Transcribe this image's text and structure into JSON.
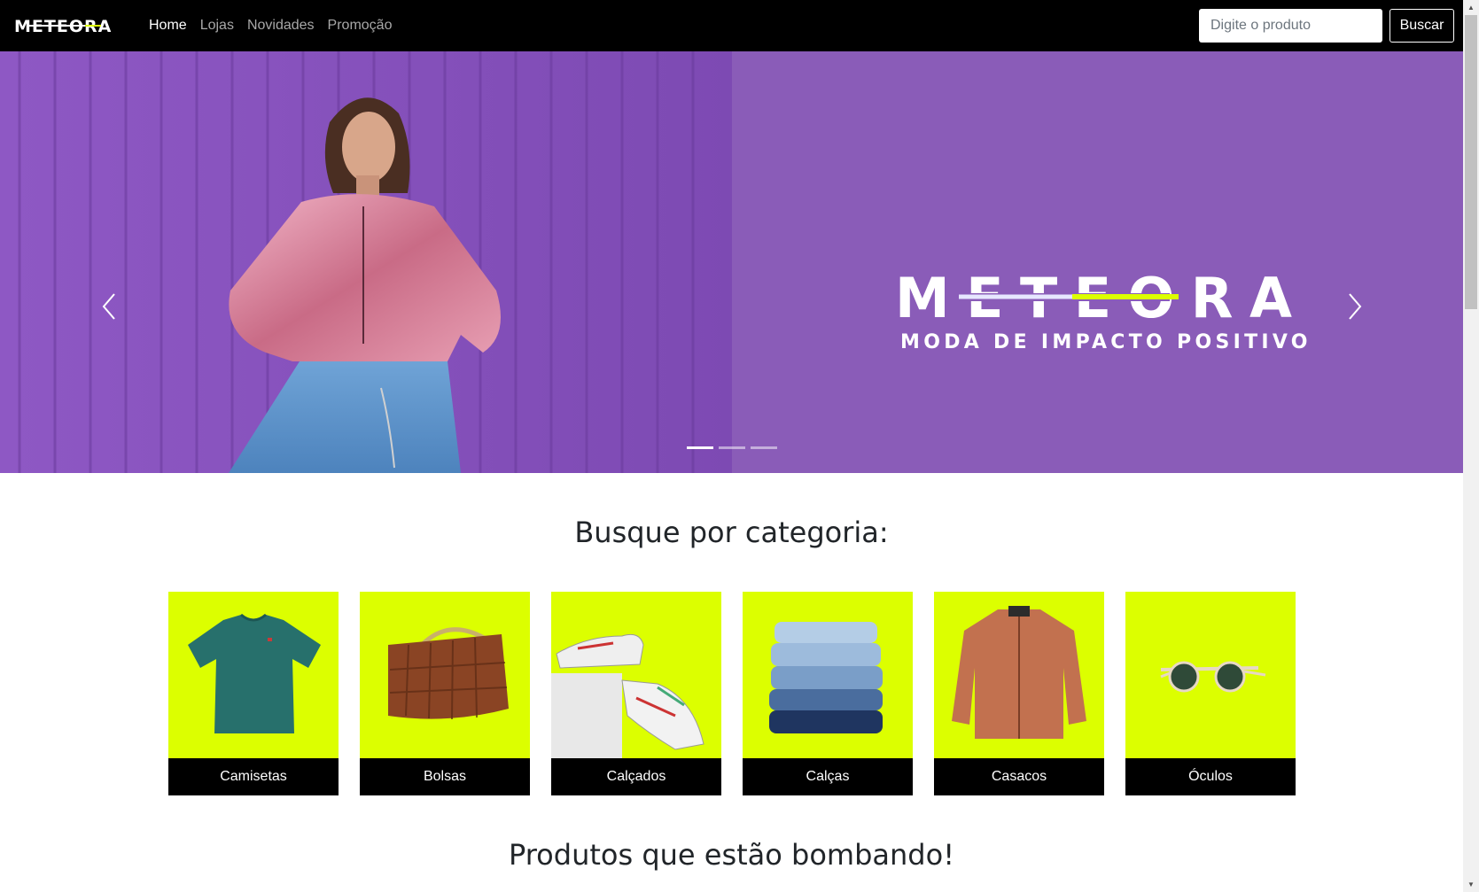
{
  "navbar": {
    "brand": "METEORA",
    "links": [
      {
        "label": "Home",
        "active": true
      },
      {
        "label": "Lojas",
        "active": false
      },
      {
        "label": "Novidades",
        "active": false
      },
      {
        "label": "Promoção",
        "active": false
      }
    ],
    "search_placeholder": "Digite o produto",
    "search_button": "Buscar"
  },
  "hero": {
    "logo_text": "METEORA",
    "tagline": "MODA DE IMPACTO POSITIVO",
    "background_color": "#8a5cb8",
    "slide_count": 3,
    "active_slide": 1,
    "prev_icon": "chevron-left-icon",
    "next_icon": "chevron-right-icon"
  },
  "categories": {
    "title": "Busque por categoria:",
    "card_color": "#dcff00",
    "items": [
      {
        "label": "Camisetas",
        "icon": "tshirt"
      },
      {
        "label": "Bolsas",
        "icon": "bag"
      },
      {
        "label": "Calçados",
        "icon": "sneakers"
      },
      {
        "label": "Calças",
        "icon": "jeans"
      },
      {
        "label": "Casacos",
        "icon": "jacket"
      },
      {
        "label": "Óculos",
        "icon": "sunglasses"
      }
    ]
  },
  "products": {
    "title": "Produtos que estão bombando!"
  }
}
